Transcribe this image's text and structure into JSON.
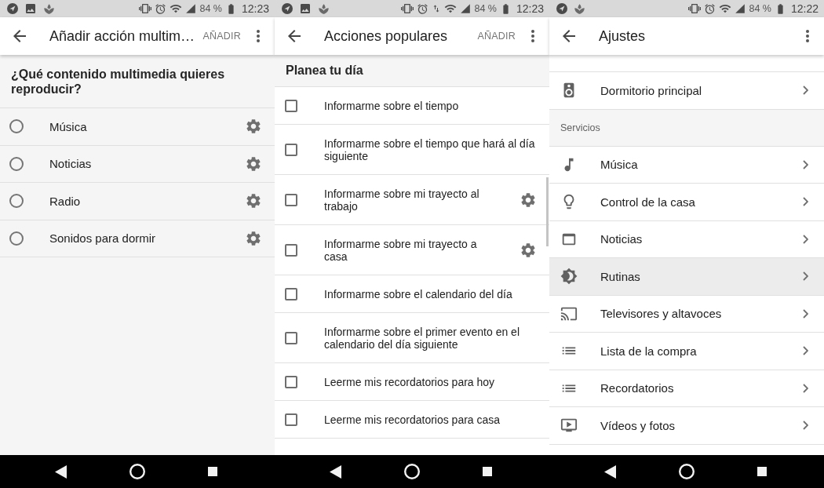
{
  "screens": [
    {
      "status_bar": {
        "notifications": [
          {
            "kind": "navigation"
          },
          {
            "kind": "image"
          },
          {
            "kind": "leaf"
          }
        ],
        "indicators": [
          {
            "kind": "vibrate"
          },
          {
            "kind": "alarm"
          },
          {
            "kind": "wifi"
          },
          {
            "kind": "signal"
          }
        ],
        "battery": "84 %",
        "time": "12:23"
      },
      "app_bar": {
        "title": "Añadir acción multim…",
        "action": "AÑADIR"
      },
      "content": {
        "kind": "radio_list",
        "heading": "¿Qué contenido multimedia quieres reproducir?",
        "items": [
          {
            "label": "Música",
            "selected": false,
            "settings": true
          },
          {
            "label": "Noticias",
            "selected": false,
            "settings": true
          },
          {
            "label": "Radio",
            "selected": false,
            "settings": true
          },
          {
            "label": "Sonidos para dormir",
            "selected": false,
            "settings": true
          }
        ]
      }
    },
    {
      "status_bar": {
        "notifications": [
          {
            "kind": "navigation"
          },
          {
            "kind": "image"
          },
          {
            "kind": "leaf"
          }
        ],
        "indicators": [
          {
            "kind": "vibrate"
          },
          {
            "kind": "alarm"
          },
          {
            "kind": "data"
          },
          {
            "kind": "wifi"
          },
          {
            "kind": "signal"
          }
        ],
        "battery": "84 %",
        "time": "12:23"
      },
      "app_bar": {
        "title": "Acciones populares",
        "action": "AÑADIR"
      },
      "content": {
        "kind": "checkbox_list",
        "heading": "Planea tu día",
        "items": [
          {
            "label": "Informarme sobre el tiempo",
            "checked": false,
            "settings": false
          },
          {
            "label": "Informarme sobre el tiempo que hará al día siguiente",
            "checked": false,
            "settings": false
          },
          {
            "label": "Informarme sobre mi trayecto al trabajo",
            "checked": false,
            "settings": true
          },
          {
            "label": "Informarme sobre mi trayecto a casa",
            "checked": false,
            "settings": true
          },
          {
            "label": "Informarme sobre el calendario del día",
            "checked": false,
            "settings": false
          },
          {
            "label": "Informarme sobre el primer evento en el calendario del día siguiente",
            "checked": false,
            "settings": false
          },
          {
            "label": "Leerme mis recordatorios para hoy",
            "checked": false,
            "settings": false
          },
          {
            "label": "Leerme mis recordatorios para casa",
            "checked": false,
            "settings": false
          }
        ]
      }
    },
    {
      "status_bar": {
        "notifications": [
          {
            "kind": "navigation"
          },
          {
            "kind": "leaf"
          }
        ],
        "indicators": [
          {
            "kind": "vibrate"
          },
          {
            "kind": "alarm"
          },
          {
            "kind": "wifi"
          },
          {
            "kind": "signal"
          }
        ],
        "battery": "84 %",
        "time": "12:22"
      },
      "app_bar": {
        "title": "Ajustes"
      },
      "content": {
        "kind": "settings_list",
        "items": [
          {
            "kind": "row",
            "label": "Dormitorio principal",
            "selected": false
          },
          {
            "kind": "section",
            "label": "Servicios"
          },
          {
            "kind": "row",
            "label": "Música",
            "selected": false
          },
          {
            "kind": "row",
            "label": "Control de la casa",
            "selected": false
          },
          {
            "kind": "row",
            "label": "Noticias",
            "selected": false
          },
          {
            "kind": "row",
            "label": "Rutinas",
            "selected": true
          },
          {
            "kind": "row",
            "label": "Televisores y altavoces",
            "selected": false
          },
          {
            "kind": "row",
            "label": "Lista de la compra",
            "selected": false
          },
          {
            "kind": "row",
            "label": "Recordatorios",
            "selected": false
          },
          {
            "kind": "row",
            "label": "Vídeos y fotos",
            "selected": false
          }
        ]
      }
    }
  ]
}
